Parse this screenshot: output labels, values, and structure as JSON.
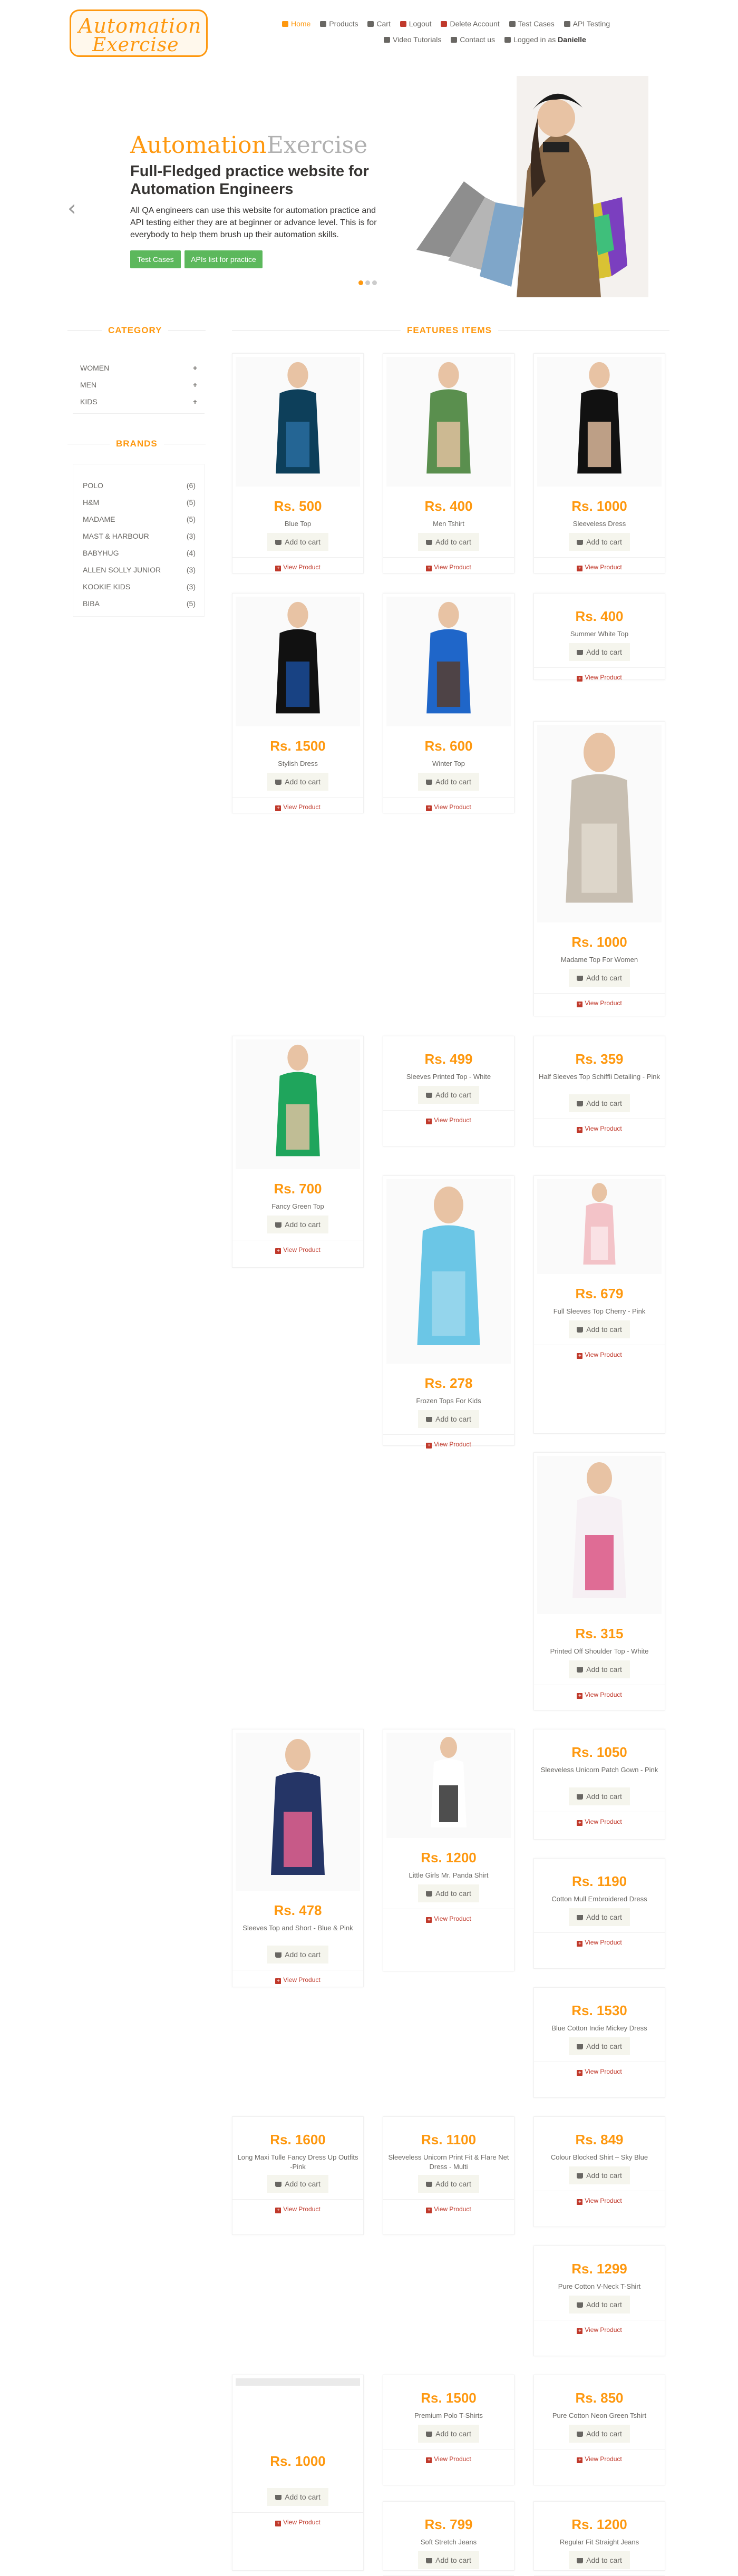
{
  "logo": {
    "part1": "Automation",
    "part2": "Exercise"
  },
  "nav": [
    {
      "label": "Home",
      "icon": "home-icon"
    },
    {
      "label": "Products",
      "icon": "products-icon"
    },
    {
      "label": "Cart",
      "icon": "cart-icon"
    },
    {
      "label": "Logout",
      "icon": "lock-icon"
    },
    {
      "label": "Delete Account",
      "icon": "trash-icon"
    },
    {
      "label": "Test Cases",
      "icon": "list-icon"
    },
    {
      "label": "API Testing",
      "icon": "list-icon"
    },
    {
      "label": "Video Tutorials",
      "icon": "youtube-icon"
    },
    {
      "label": "Contact us",
      "icon": "envelope-icon"
    }
  ],
  "logged_in": {
    "prefix": "Logged in as",
    "user": "Danielle"
  },
  "slider": {
    "brand_a": "Automation",
    "brand_b": "Exercise",
    "heading": "Full-Fledged practice website for Automation Engineers",
    "text": "All QA engineers can use this website for automation practice and API testing either they are at beginner or advance level. This is for everybody to help them brush up their automation skills.",
    "btn_test_cases": "Test Cases",
    "btn_apis": "APIs list for practice",
    "prev": "‹",
    "next": "›"
  },
  "sidebar": {
    "category_title": "CATEGORY",
    "categories": [
      "WOMEN",
      "MEN",
      "KIDS"
    ],
    "plus": "+",
    "brands_title": "BRANDS",
    "brands": [
      {
        "name": "POLO",
        "count": "(6)"
      },
      {
        "name": "H&M",
        "count": "(5)"
      },
      {
        "name": "MADAME",
        "count": "(5)"
      },
      {
        "name": "MAST & HARBOUR",
        "count": "(3)"
      },
      {
        "name": "BABYHUG",
        "count": "(4)"
      },
      {
        "name": "ALLEN SOLLY JUNIOR",
        "count": "(3)"
      },
      {
        "name": "KOOKIE KIDS",
        "count": "(3)"
      },
      {
        "name": "BIBA",
        "count": "(5)"
      }
    ]
  },
  "features_title": "FEATURES ITEMS",
  "add_label": "Add to cart",
  "view_label": "View Product",
  "products": [
    {
      "price": "Rs. 500",
      "name": "Blue Top"
    },
    {
      "price": "Rs. 400",
      "name": "Men Tshirt"
    },
    {
      "price": "Rs. 1000",
      "name": "Sleeveless Dress"
    },
    {
      "price": "Rs. 1500",
      "name": "Stylish Dress"
    },
    {
      "price": "Rs. 600",
      "name": "Winter Top"
    },
    {
      "price": "Rs. 400",
      "name": "Summer White Top"
    },
    {
      "price": "Rs. 1000",
      "name": "Madame Top For Women"
    },
    {
      "price": "Rs. 700",
      "name": "Fancy Green Top"
    },
    {
      "price": "Rs. 499",
      "name": "Sleeves Printed Top - White"
    },
    {
      "price": "Rs. 359",
      "name": "Half Sleeves Top Schiffli Detailing - Pink"
    },
    {
      "price": "Rs. 278",
      "name": "Frozen Tops For Kids"
    },
    {
      "price": "Rs. 679",
      "name": "Full Sleeves Top Cherry - Pink"
    },
    {
      "price": "Rs. 315",
      "name": "Printed Off Shoulder Top - White"
    },
    {
      "price": "Rs. 478",
      "name": "Sleeves Top and Short - Blue & Pink"
    },
    {
      "price": "Rs. 1200",
      "name": "Little Girls Mr. Panda Shirt"
    },
    {
      "price": "Rs. 1050",
      "name": "Sleeveless Unicorn Patch Gown - Pink"
    },
    {
      "price": "Rs. 1190",
      "name": "Cotton Mull Embroidered Dress"
    },
    {
      "price": "Rs. 1530",
      "name": "Blue Cotton Indie Mickey Dress"
    },
    {
      "price": "Rs. 1600",
      "name": "Long Maxi Tulle Fancy Dress Up Outfits -Pink"
    },
    {
      "price": "Rs. 1100",
      "name": "Sleeveless Unicorn Print Fit & Flare Net Dress - Multi"
    },
    {
      "price": "Rs. 849",
      "name": "Colour Blocked Shirt – Sky Blue"
    },
    {
      "price": "Rs. 1299",
      "name": "Pure Cotton V-Neck T-Shirt"
    },
    {
      "price": "Rs. 1500",
      "name": "Premium Polo T-Shirts"
    },
    {
      "price": "Rs. 850",
      "name": "Pure Cotton Neon Green Tshirt"
    },
    {
      "price": "Rs. 799",
      "name": "Soft Stretch Jeans"
    },
    {
      "price": "Rs. 1200",
      "name": "Regular Fit Straight Jeans"
    },
    {
      "price": "Rs. 1000",
      "name": ""
    }
  ]
}
